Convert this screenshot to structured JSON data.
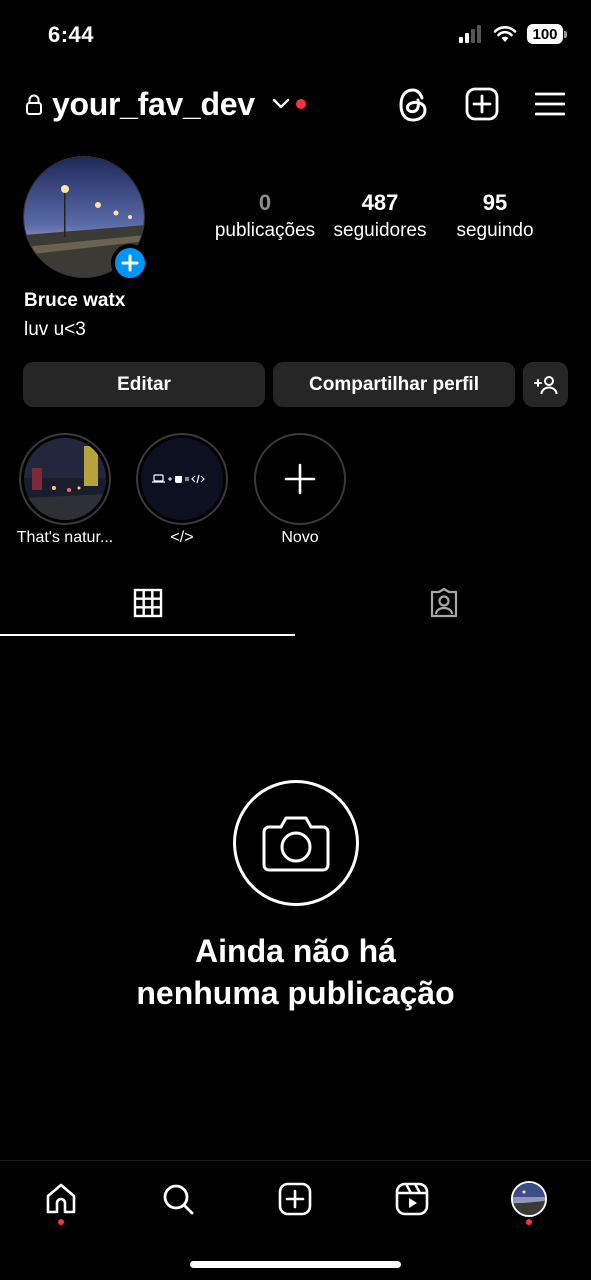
{
  "status_bar": {
    "time": "6:44",
    "battery": "100"
  },
  "header": {
    "username": "your_fav_dev"
  },
  "profile": {
    "display_name": "Bruce watx",
    "bio": "luv u<3",
    "stats": [
      {
        "value": "0",
        "label": "publicações"
      },
      {
        "value": "487",
        "label": "seguidores"
      },
      {
        "value": "95",
        "label": "seguindo"
      }
    ]
  },
  "actions": {
    "edit_label": "Editar",
    "share_label": "Compartilhar perfil"
  },
  "highlights": [
    {
      "label": "That's natur..."
    },
    {
      "label": "</>"
    },
    {
      "label": "Novo"
    }
  ],
  "empty_state": {
    "title_line1": "Ainda não há",
    "title_line2": "nenhuma publicação"
  },
  "colors": {
    "accent_blue": "#0095f6",
    "notification_red": "#ff3040",
    "button_bg": "#262626"
  }
}
